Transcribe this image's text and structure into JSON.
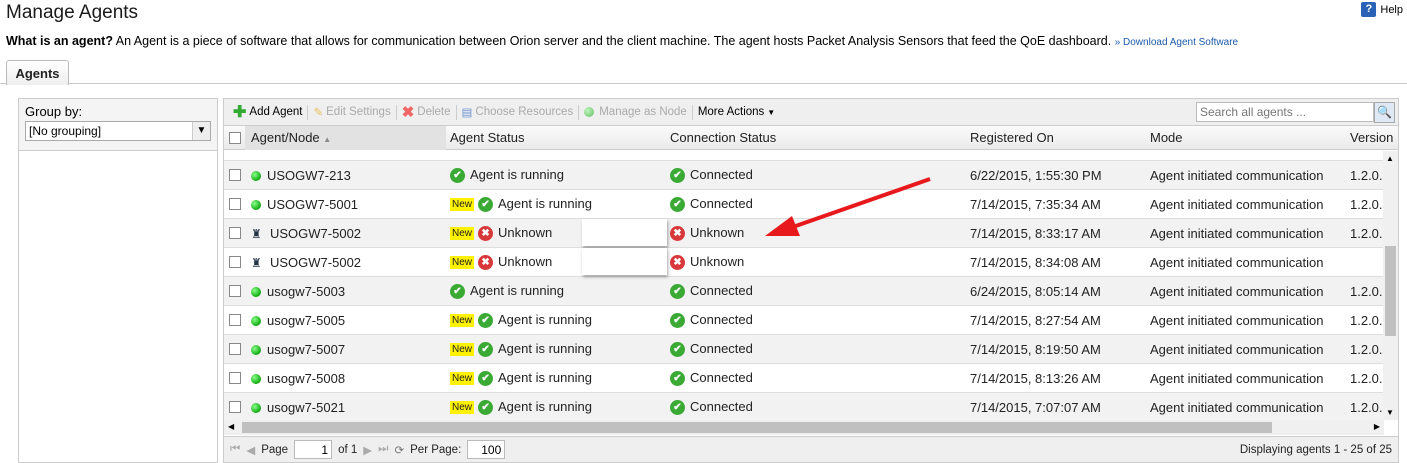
{
  "page": {
    "title": "Manage Agents",
    "help": "Help",
    "desc_bold": "What is an agent?",
    "desc": " An Agent is a piece of software that allows for communication between Orion server and the client machine. The agent hosts Packet Analysis Sensors that feed the QoE dashboard. ",
    "download_link": "» Download Agent Software",
    "tab": "Agents"
  },
  "left": {
    "group_label": "Group by:",
    "group_value": "[No grouping]"
  },
  "toolbar": {
    "add": "Add Agent",
    "edit": "Edit Settings",
    "delete": "Delete",
    "choose": "Choose Resources",
    "manage": "Manage as Node",
    "more": "More Actions",
    "search_placeholder": "Search all agents ..."
  },
  "columns": [
    "Agent/Node",
    "Agent Status",
    "Connection Status",
    "Registered On",
    "Mode",
    "Version"
  ],
  "rows": [
    {
      "name": "USOGW7-213",
      "icon": "green",
      "new": false,
      "agent": "Agent is running",
      "aok": true,
      "conn": "Connected",
      "cok": true,
      "reg": "6/22/2015, 1:55:30 PM",
      "mode": "Agent initiated communication",
      "ver": "1.2.0."
    },
    {
      "name": "USOGW7-5001",
      "icon": "green",
      "new": true,
      "agent": "Agent is running",
      "aok": true,
      "conn": "Connected",
      "cok": true,
      "reg": "7/14/2015, 7:35:34 AM",
      "mode": "Agent initiated communication",
      "ver": "1.2.0."
    },
    {
      "name": "USOGW7-5002",
      "icon": "spy",
      "new": true,
      "agent": "Unknown",
      "aok": false,
      "conn": "Unknown",
      "cok": false,
      "reg": "7/14/2015, 8:33:17 AM",
      "mode": "Agent initiated communication",
      "ver": "1.2.0."
    },
    {
      "name": "USOGW7-5002",
      "icon": "spy",
      "new": true,
      "agent": "Unknown",
      "aok": false,
      "conn": "Unknown",
      "cok": false,
      "reg": "7/14/2015, 8:34:08 AM",
      "mode": "Agent initiated communication",
      "ver": ""
    },
    {
      "name": "usogw7-5003",
      "icon": "green",
      "new": false,
      "agent": "Agent is running",
      "aok": true,
      "conn": "Connected",
      "cok": true,
      "reg": "6/24/2015, 8:05:14 AM",
      "mode": "Agent initiated communication",
      "ver": "1.2.0."
    },
    {
      "name": "usogw7-5005",
      "icon": "green",
      "new": true,
      "agent": "Agent is running",
      "aok": true,
      "conn": "Connected",
      "cok": true,
      "reg": "7/14/2015, 8:27:54 AM",
      "mode": "Agent initiated communication",
      "ver": "1.2.0."
    },
    {
      "name": "usogw7-5007",
      "icon": "green",
      "new": true,
      "agent": "Agent is running",
      "aok": true,
      "conn": "Connected",
      "cok": true,
      "reg": "7/14/2015, 8:19:50 AM",
      "mode": "Agent initiated communication",
      "ver": "1.2.0."
    },
    {
      "name": "usogw7-5008",
      "icon": "green",
      "new": true,
      "agent": "Agent is running",
      "aok": true,
      "conn": "Connected",
      "cok": true,
      "reg": "7/14/2015, 8:13:26 AM",
      "mode": "Agent initiated communication",
      "ver": "1.2.0."
    },
    {
      "name": "usogw7-5021",
      "icon": "green",
      "new": true,
      "agent": "Agent is running",
      "aok": true,
      "conn": "Connected",
      "cok": true,
      "reg": "7/14/2015, 7:07:07 AM",
      "mode": "Agent initiated communication",
      "ver": "1.2.0."
    }
  ],
  "new_badge": "New",
  "pager": {
    "page_label": "Page",
    "page": "1",
    "of": "of 1",
    "per_page_label": "Per Page:",
    "per_page": "100",
    "display": "Displaying agents 1 - 25 of 25"
  },
  "colors": {
    "arrow": "#e8191c",
    "new": "#fff200"
  }
}
